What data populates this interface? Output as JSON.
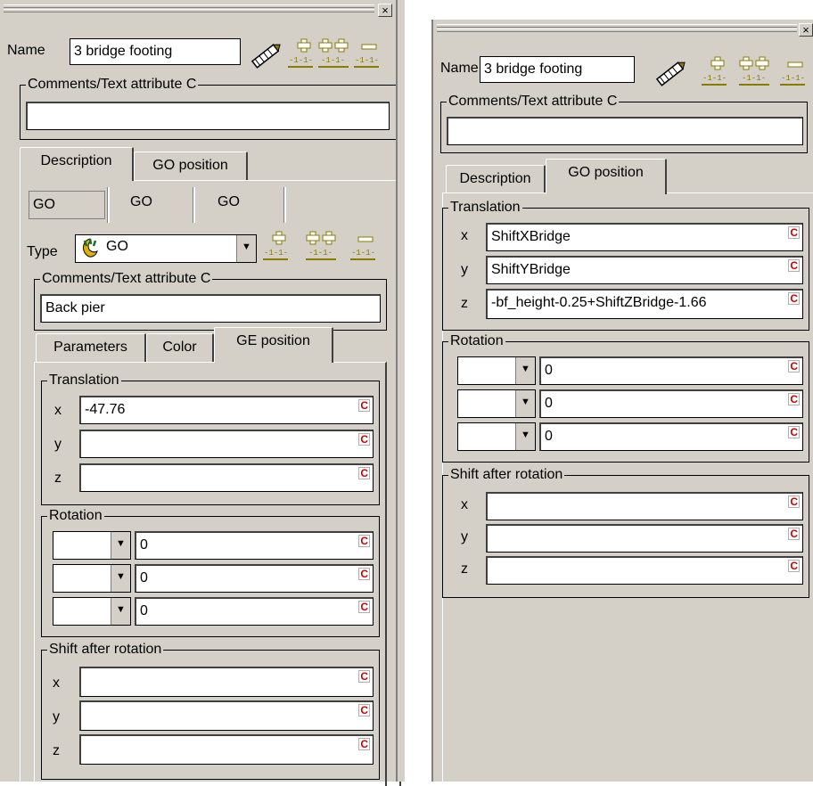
{
  "left": {
    "close_glyph": "×",
    "name_label": "Name",
    "name_value": "3 bridge footing",
    "comments_title": "Comments/Text attribute C",
    "comments_value": "",
    "main_tabs": [
      "Description",
      "GO position"
    ],
    "go_buttons": [
      "GO",
      "GO",
      "GO"
    ],
    "type_label": "Type",
    "type_value": "GO",
    "comments2_title": "Comments/Text attribute C",
    "comments2_value": "Back pier",
    "sub_tabs": [
      "Parameters",
      "Color",
      "GE position"
    ],
    "translation_title": "Translation",
    "axes": [
      "x",
      "y",
      "z"
    ],
    "translation_values": [
      "-47.76",
      "",
      ""
    ],
    "rotation_title": "Rotation",
    "rotation_values": [
      "0",
      "0",
      "0"
    ],
    "shift_title": "Shift after rotation",
    "shift_values": [
      "",
      "",
      ""
    ],
    "c_mark": "C"
  },
  "right": {
    "close_glyph": "×",
    "name_label": "Name",
    "name_value": "3 bridge footing",
    "comments_title": "Comments/Text attribute C",
    "comments_value": "",
    "main_tabs": [
      "Description",
      "GO position"
    ],
    "translation_title": "Translation",
    "axes": [
      "x",
      "y",
      "z"
    ],
    "translation_values": [
      "ShiftXBridge",
      "ShiftYBridge",
      "-bf_height-0.25+ShiftZBridge-1.66"
    ],
    "rotation_title": "Rotation",
    "rotation_values": [
      "0",
      "0",
      "0"
    ],
    "shift_title": "Shift after rotation",
    "shift_values": [
      "",
      "",
      ""
    ],
    "c_mark": "C"
  },
  "icons": {
    "edit": "pencil-icon",
    "add_one": "add-item-icon",
    "add_two": "add-items-icon",
    "remove": "remove-item-icon",
    "type": "go-type-icon"
  },
  "colors": {
    "panel": "#d4d0c8",
    "c_mark": "#d00000",
    "icon_olive": "#8a7a00",
    "type_icon": "#1a6e2a"
  }
}
